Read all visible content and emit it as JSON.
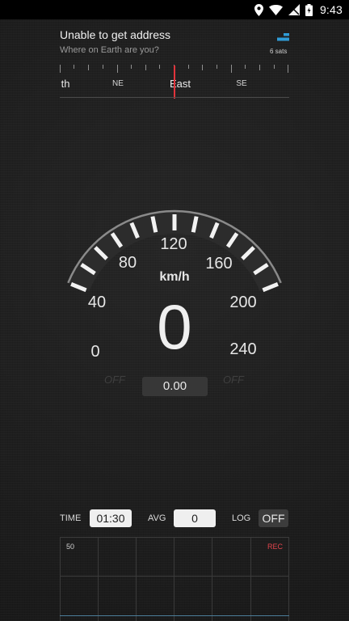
{
  "status_bar": {
    "time": "9:43",
    "icons": [
      "location-icon",
      "wifi-icon",
      "signal-icon",
      "battery-charging-icon"
    ]
  },
  "location": {
    "title": "Unable to get address",
    "subtitle": "Where on Earth are you?",
    "satellites": "6 sats",
    "satellite_icon": "satellite-signal-icon"
  },
  "compass": {
    "labels": [
      "th",
      "NE",
      "East",
      "SE"
    ],
    "needle_color": "#e2333b"
  },
  "speedometer": {
    "unit": "km/h",
    "speed": "0",
    "scale_labels": [
      "0",
      "40",
      "80",
      "120",
      "160",
      "200",
      "240"
    ],
    "left_indicator": "OFF",
    "right_indicator": "OFF",
    "trip_distance": "0.00"
  },
  "controls": {
    "time_label": "TIME",
    "time_value": "01:30",
    "avg_label": "AVG",
    "avg_value": "0",
    "log_label": "LOG",
    "log_value": "OFF"
  },
  "graph": {
    "max_label": "50",
    "rec_label": "REC",
    "rec_color": "#e0444c",
    "line_color": "#4d7f9c"
  }
}
